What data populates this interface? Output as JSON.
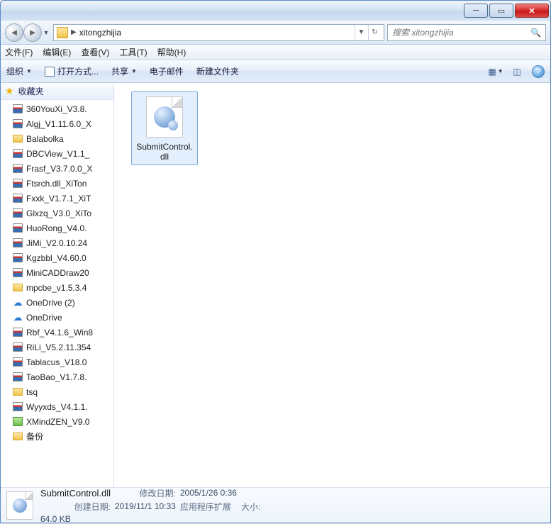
{
  "address": {
    "folder": "xitongzhijia"
  },
  "search": {
    "placeholder": "搜索 xitongzhijia"
  },
  "menu": {
    "file": "文件(F)",
    "edit": "编辑(E)",
    "view": "查看(V)",
    "tools": "工具(T)",
    "help": "帮助(H)"
  },
  "toolbar": {
    "organize": "组织",
    "openwith": "打开方式...",
    "share": "共享",
    "email": "电子邮件",
    "newfolder": "新建文件夹"
  },
  "sidebar": {
    "favorites_label": "收藏夹",
    "items": [
      {
        "icon": "rar",
        "label": "360YouXi_V3.8."
      },
      {
        "icon": "rar",
        "label": "Algj_V1.11.6.0_X"
      },
      {
        "icon": "folder",
        "label": "Balabolka"
      },
      {
        "icon": "rar",
        "label": "DBCView_V1.1_"
      },
      {
        "icon": "rar",
        "label": "Frasf_V3.7.0.0_X"
      },
      {
        "icon": "rar",
        "label": "Ftsrch.dll_XiTon"
      },
      {
        "icon": "rar",
        "label": "Fxxk_V1.7.1_XiT"
      },
      {
        "icon": "rar",
        "label": "Glxzq_V3.0_XiTo"
      },
      {
        "icon": "rar",
        "label": "HuoRong_V4.0."
      },
      {
        "icon": "rar",
        "label": "JiMi_V2.0.10.24"
      },
      {
        "icon": "rar",
        "label": "Kgzbbl_V4.60.0"
      },
      {
        "icon": "rar",
        "label": "MiniCADDraw20"
      },
      {
        "icon": "folder",
        "label": "mpcbe_v1.5.3.4"
      },
      {
        "icon": "cloud",
        "label": "OneDrive (2)"
      },
      {
        "icon": "cloud",
        "label": "OneDrive"
      },
      {
        "icon": "rar",
        "label": "Rbf_V4.1.6_Win8"
      },
      {
        "icon": "rar",
        "label": "RiLi_V5.2.11.354"
      },
      {
        "icon": "rar",
        "label": "Tablacus_V18.0"
      },
      {
        "icon": "rar",
        "label": "TaoBao_V1.7.8."
      },
      {
        "icon": "folder",
        "label": "tsq"
      },
      {
        "icon": "rar",
        "label": "Wyyxds_V4.1.1."
      },
      {
        "icon": "green",
        "label": "XMindZEN_V9.0"
      },
      {
        "icon": "folder",
        "label": "备份"
      }
    ]
  },
  "content": {
    "file": {
      "line1": "SubmitControl.",
      "line2": "dll"
    }
  },
  "details": {
    "name": "SubmitControl.dll",
    "type": "应用程序扩展",
    "mod_label": "修改日期:",
    "mod_val": "2005/1/26 0:36",
    "size_label": "大小:",
    "size_val": "64.0 KB",
    "create_label": "创建日期:",
    "create_val": "2019/11/1 10:33"
  }
}
